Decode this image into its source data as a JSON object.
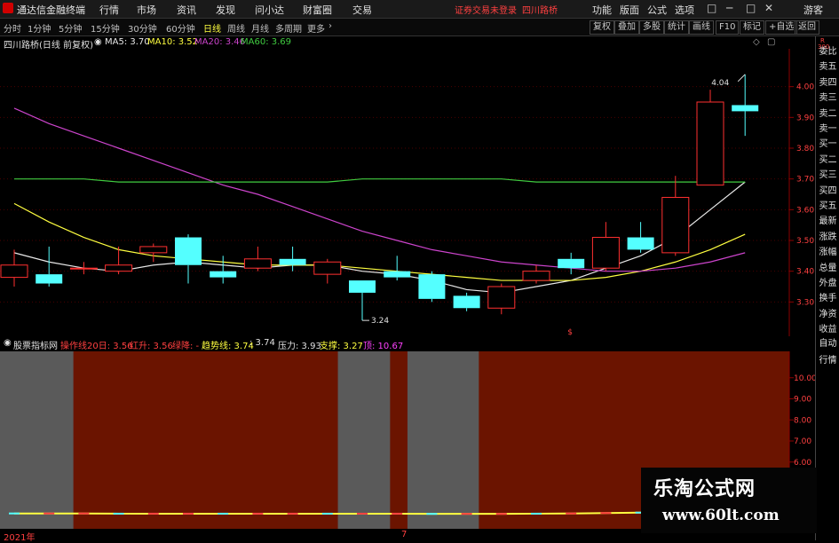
{
  "app": {
    "title": "通达信金融终端",
    "menu": [
      "行情",
      "市场",
      "资讯",
      "发现",
      "问小达",
      "财富圈",
      "交易"
    ],
    "notice": "证券交易未登录",
    "stock_tag": "四川路桥",
    "right_menu": [
      "功能",
      "版面",
      "公式",
      "选项"
    ],
    "user": "游客",
    "window_controls": [
      "□",
      "─",
      "□",
      "✕"
    ]
  },
  "periods": {
    "items": [
      "分时",
      "1分钟",
      "5分钟",
      "15分钟",
      "30分钟",
      "60分钟",
      "日线",
      "周线",
      "月线",
      "多周期",
      "更多"
    ],
    "active": "日线",
    "more_icon": "chevron-right-icon"
  },
  "toolbar": {
    "buttons": [
      "复权",
      "叠加",
      "多股",
      "统计",
      "画线",
      "F10",
      "标记",
      "+自选",
      "返回"
    ]
  },
  "main_info": {
    "stock_label": "四川路桥(日线 前复权)",
    "ma": [
      {
        "label": "MA5: 3.70",
        "color": "#e8e8e8"
      },
      {
        "label": "MA10: 3.52",
        "color": "#ffff40"
      },
      {
        "label": "MA20: 3.46",
        "color": "#cc44cc"
      },
      {
        "label": "MA60: 3.69",
        "color": "#40cc40"
      }
    ]
  },
  "indicator_info": {
    "name": "股票指标网",
    "items": [
      {
        "label": "操作线20日: 3.56",
        "color": "#ff4040"
      },
      {
        "label": "红升: 3.56",
        "color": "#ff4040"
      },
      {
        "label": "绿降: -",
        "color": "#ff4040"
      },
      {
        "label": "趋势线: 3.74",
        "color": "#ffff40"
      },
      {
        "label": ": 3.74",
        "color": "#e0e0e0"
      },
      {
        "label": "压力: 3.93",
        "color": "#e0e0e0"
      },
      {
        "label": "支撑: 3.27",
        "color": "#ffff40"
      },
      {
        "label": "顶: 10.67",
        "color": "#ff40ff"
      }
    ]
  },
  "side_tabs": [
    "委比",
    "卖五",
    "卖四",
    "卖三",
    "卖二",
    "卖一",
    "买一",
    "买二",
    "买三",
    "买四",
    "买五",
    "最新",
    "涨跌",
    "涨幅",
    "总量",
    "外盘",
    "换手",
    "净资",
    "收益",
    "自动",
    "行情"
  ],
  "side_tabs_top": [
    "R",
    "300"
  ],
  "bottom": {
    "year_label": "2021年",
    "month_label": "7"
  },
  "watermark": {
    "line1": "乐淘公式网",
    "line2": "www.60lt.com"
  },
  "chart_data": [
    {
      "type": "candlestick",
      "name": "main",
      "ylim": [
        3.2,
        4.1
      ],
      "y_ticks": [
        "4.00",
        "3.90",
        "3.80",
        "3.70",
        "3.60",
        "3.50",
        "3.40",
        "3.30"
      ],
      "annotations": {
        "high": "4.04",
        "low": "3.24",
        "marker": "$"
      },
      "candles": [
        {
          "o": 3.38,
          "c": 3.42,
          "h": 3.47,
          "l": 3.35
        },
        {
          "o": 3.39,
          "c": 3.36,
          "h": 3.48,
          "l": 3.35
        },
        {
          "o": 3.41,
          "c": 3.41,
          "h": 3.43,
          "l": 3.39
        },
        {
          "o": 3.4,
          "c": 3.42,
          "h": 3.48,
          "l": 3.39
        },
        {
          "o": 3.46,
          "c": 3.48,
          "h": 3.49,
          "l": 3.43
        },
        {
          "o": 3.51,
          "c": 3.42,
          "h": 3.52,
          "l": 3.36
        },
        {
          "o": 3.4,
          "c": 3.38,
          "h": 3.45,
          "l": 3.36
        },
        {
          "o": 3.41,
          "c": 3.44,
          "h": 3.48,
          "l": 3.4
        },
        {
          "o": 3.44,
          "c": 3.42,
          "h": 3.48,
          "l": 3.4
        },
        {
          "o": 3.39,
          "c": 3.43,
          "h": 3.44,
          "l": 3.36
        },
        {
          "o": 3.37,
          "c": 3.33,
          "h": 3.37,
          "l": 3.24
        },
        {
          "o": 3.4,
          "c": 3.38,
          "h": 3.45,
          "l": 3.37
        },
        {
          "o": 3.39,
          "c": 3.31,
          "h": 3.4,
          "l": 3.3
        },
        {
          "o": 3.32,
          "c": 3.28,
          "h": 3.33,
          "l": 3.27
        },
        {
          "o": 3.28,
          "c": 3.35,
          "h": 3.36,
          "l": 3.26
        },
        {
          "o": 3.37,
          "c": 3.4,
          "h": 3.42,
          "l": 3.36
        },
        {
          "o": 3.44,
          "c": 3.41,
          "h": 3.46,
          "l": 3.39
        },
        {
          "o": 3.41,
          "c": 3.51,
          "h": 3.56,
          "l": 3.4
        },
        {
          "o": 3.51,
          "c": 3.47,
          "h": 3.56,
          "l": 3.46
        },
        {
          "o": 3.46,
          "c": 3.64,
          "h": 3.71,
          "l": 3.45
        },
        {
          "o": 3.68,
          "c": 3.95,
          "h": 3.99,
          "l": 3.68
        },
        {
          "o": 3.94,
          "c": 3.92,
          "h": 4.04,
          "l": 3.84
        }
      ],
      "series": [
        {
          "name": "MA5",
          "color": "#e8e8e8",
          "values": [
            3.46,
            3.43,
            3.41,
            3.4,
            3.42,
            3.43,
            3.42,
            3.41,
            3.42,
            3.42,
            3.4,
            3.39,
            3.37,
            3.34,
            3.33,
            3.35,
            3.37,
            3.41,
            3.45,
            3.51,
            3.6,
            3.69
          ]
        },
        {
          "name": "MA10",
          "color": "#ffff40",
          "values": [
            3.62,
            3.56,
            3.51,
            3.47,
            3.45,
            3.44,
            3.43,
            3.42,
            3.42,
            3.42,
            3.41,
            3.4,
            3.39,
            3.38,
            3.37,
            3.37,
            3.37,
            3.38,
            3.4,
            3.43,
            3.47,
            3.52
          ]
        },
        {
          "name": "MA20",
          "color": "#cc44cc",
          "values": [
            3.93,
            3.88,
            3.84,
            3.8,
            3.76,
            3.72,
            3.68,
            3.65,
            3.61,
            3.57,
            3.53,
            3.5,
            3.47,
            3.45,
            3.43,
            3.42,
            3.41,
            3.4,
            3.4,
            3.41,
            3.43,
            3.46
          ]
        },
        {
          "name": "MA60",
          "color": "#40cc40",
          "values": [
            3.7,
            3.7,
            3.7,
            3.69,
            3.69,
            3.69,
            3.69,
            3.69,
            3.69,
            3.69,
            3.7,
            3.7,
            3.7,
            3.7,
            3.7,
            3.69,
            3.69,
            3.69,
            3.69,
            3.69,
            3.69,
            3.69
          ]
        }
      ]
    },
    {
      "type": "area",
      "name": "indicator",
      "ylim": [
        3.0,
        11.0
      ],
      "y_ticks": [
        "10.00",
        "9.00",
        "8.00",
        "7.00",
        "6.00",
        "5.00",
        "4.00"
      ],
      "bands": [
        "red",
        "gray",
        "red",
        "gray",
        "red",
        "gray",
        "red"
      ],
      "band_spans": [
        [
          0,
          2
        ],
        [
          2,
          9.5
        ],
        [
          9.5,
          11
        ],
        [
          11,
          11.5
        ],
        [
          11.5,
          14
        ],
        [
          14,
          22
        ]
      ],
      "series": [
        {
          "name": "趋势线",
          "color": "#ffff40",
          "values": [
            3.56,
            3.56,
            3.56,
            3.55,
            3.55,
            3.55,
            3.55,
            3.55,
            3.55,
            3.55,
            3.55,
            3.55,
            3.54,
            3.54,
            3.54,
            3.55,
            3.56,
            3.58,
            3.6,
            3.62,
            3.68,
            3.74
          ]
        }
      ]
    }
  ]
}
